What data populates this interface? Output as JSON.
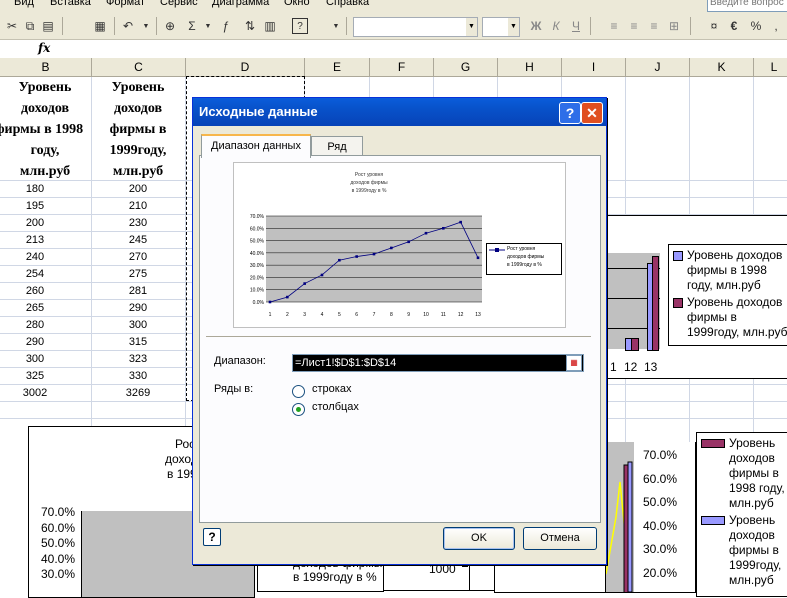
{
  "menu": {
    "items": [
      "Вид",
      "Вставка",
      "Формат",
      "Сервис",
      "Диаграмма",
      "Окно",
      "Справка"
    ],
    "help_placeholder": "Введите вопрос"
  },
  "formula_bar": {
    "fx": "fx"
  },
  "columns": [
    "B",
    "C",
    "D",
    "E",
    "F",
    "G",
    "H",
    "I",
    "J",
    "K",
    "L"
  ],
  "table": {
    "header_b": [
      "Уровень",
      "доходов",
      "фирмы в 1998",
      "году,",
      "млн.руб"
    ],
    "header_c": [
      "Уровень",
      "доходов",
      "фирмы в",
      "1999году,",
      "млн.руб"
    ],
    "col_b": [
      "180",
      "195",
      "200",
      "213",
      "240",
      "254",
      "260",
      "265",
      "280",
      "290",
      "300",
      "325",
      "3002"
    ],
    "col_c": [
      "200",
      "210",
      "230",
      "245",
      "270",
      "275",
      "281",
      "290",
      "300",
      "315",
      "323",
      "330",
      "3269"
    ]
  },
  "right_chart": {
    "legend": [
      {
        "label": "Уровень доходов фирмы в 1998 году, млн.руб",
        "color": "#9999ff"
      },
      {
        "label": "Уровень доходов фирмы в 1999году, млн.руб",
        "color": "#993366"
      }
    ],
    "visible_ticks": [
      "1",
      "12",
      "13"
    ]
  },
  "bottom_left_chart": {
    "title_fragments": [
      "Рост",
      "доходо",
      "в 1999"
    ],
    "yticks": [
      "70.0%",
      "60.0%",
      "50.0%",
      "40.0%",
      "30.0%"
    ]
  },
  "bottom_mid_chart": {
    "legend_fragments": [
      "доходов фирмы",
      "в 1999году в %"
    ],
    "tick": "1000"
  },
  "bottom_right_chart": {
    "yticks": [
      "70.0%",
      "60.0%",
      "50.0%",
      "40.0%",
      "30.0%",
      "20.0%"
    ],
    "legend": [
      {
        "label": "Уровень доходов фирмы в 1998 году, млн.руб",
        "color": "#993366"
      },
      {
        "label": "Уровень доходов фирмы в 1999году, млн.руб",
        "color": "#9999ff"
      }
    ]
  },
  "dialog": {
    "title": "Исходные данные",
    "tabs": [
      "Диапазон данных",
      "Ряд"
    ],
    "range_label": "Диапазон:",
    "range_value": "=Лист1!$D$1:$D$14",
    "series_in_label": "Ряды в:",
    "radio_rows": "строках",
    "radio_columns": "столбцах",
    "selected": "столбцах",
    "ok": "OK",
    "cancel": "Отмена",
    "help_icon": "question-icon",
    "close_color": "#e04f20"
  },
  "preview_chart": {
    "title_lines": [
      "Рост уровня",
      "доходов фирмы",
      "в 1999году в %"
    ],
    "legend_lines": [
      "Рост уровня",
      "доходов фирмы",
      "в 1999году в %"
    ],
    "line_color": "#000080",
    "plot_bg": "#c0c0c0"
  },
  "chart_data": {
    "type": "line",
    "title": "Рост уровня доходов фирмы в 1999году в %",
    "x": [
      1,
      2,
      3,
      4,
      5,
      6,
      7,
      8,
      9,
      10,
      11,
      12,
      13
    ],
    "series": [
      {
        "name": "Рост уровня доходов фирмы в 1999году в %",
        "values": [
          0.0,
          4.0,
          15.0,
          22.0,
          34.0,
          37.0,
          39.0,
          44.0,
          49.0,
          56.0,
          60.0,
          65.0,
          36.0
        ]
      }
    ],
    "yticks": [
      "0.0%",
      "10.0%",
      "20.0%",
      "30.0%",
      "40.0%",
      "50.0%",
      "60.0%",
      "70.0%"
    ],
    "ylim": [
      0,
      70
    ],
    "grid": true,
    "legend": "right"
  }
}
